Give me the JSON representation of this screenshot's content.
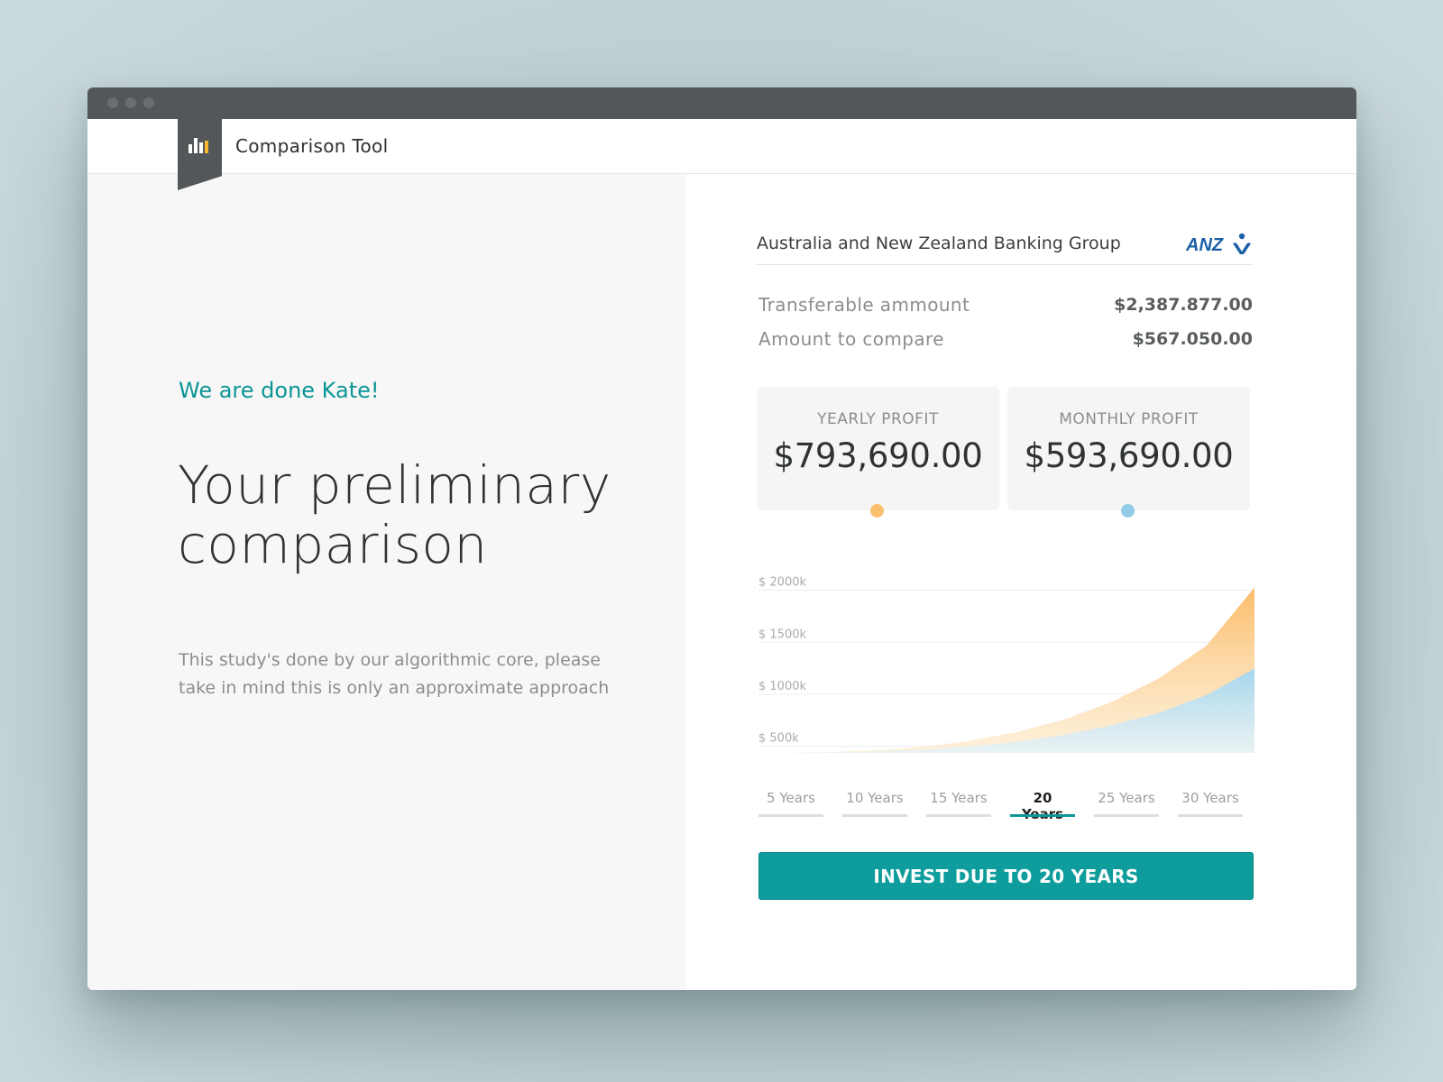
{
  "app": {
    "title": "Comparison Tool",
    "logo_icon": "bar-chart-icon"
  },
  "left": {
    "greeting": "We are done Kate!",
    "headline_line1": "Your preliminary",
    "headline_line2": "comparison",
    "description": "This study's done by our algorithmic core, please take in mind this is only an approximate approach"
  },
  "bank": {
    "name": "Australia and New Zealand Banking Group",
    "logo_text": "ANZ"
  },
  "amounts": [
    {
      "label": "Transferable ammount",
      "value": "$2,387.877.00"
    },
    {
      "label": "Amount to compare",
      "value": "$567.050.00"
    }
  ],
  "profits": [
    {
      "label": "YEARLY PROFIT",
      "value": "$793,690.00",
      "color": "#fbc06e"
    },
    {
      "label": "MONTHLY PROFIT",
      "value": "$593,690.00",
      "color": "#92cbe6"
    }
  ],
  "chart_data": {
    "type": "area",
    "title": "",
    "xlabel": "",
    "ylabel": "",
    "ytick_labels": [
      "$ 2000k",
      "$ 1500k",
      "$ 1000k",
      "$ 500k"
    ],
    "ylim": [
      350,
      2100
    ],
    "x": [
      0,
      2,
      4,
      6,
      8,
      10,
      12,
      14,
      16,
      18,
      20
    ],
    "series": [
      {
        "color": "#fbc06e",
        "values": [
          350,
          356,
          372,
          405,
          462,
          545,
          665,
          835,
          1065,
          1380,
          1940
        ]
      },
      {
        "color": "#92cbe6",
        "values": [
          350,
          353,
          362,
          380,
          410,
          455,
          520,
          610,
          735,
          905,
          1160
        ]
      }
    ],
    "grid": true
  },
  "tabs": [
    {
      "label": "5 Years",
      "active": false
    },
    {
      "label": "10 Years",
      "active": false
    },
    {
      "label": "15 Years",
      "active": false
    },
    {
      "label": "20 Years",
      "active": true
    },
    {
      "label": "25 Years",
      "active": false
    },
    {
      "label": "30 Years",
      "active": false
    }
  ],
  "cta_label": "INVEST DUE TO 20 YEARS",
  "colors": {
    "accent": "#0f9c9c",
    "yearly": "#fbc06e",
    "monthly": "#92cbe6",
    "anz_blue": "#1b60a8"
  }
}
